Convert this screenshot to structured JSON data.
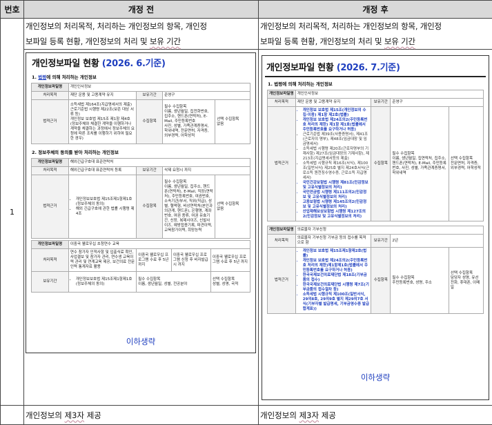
{
  "header": {
    "no": "번호",
    "before": "개정 전",
    "after": "개정 후"
  },
  "row1": {
    "no": "1",
    "topic_a1": "개인정보의 처리목적, 처리하는 개인정보의 항목, 개인정",
    "topic_a2_pre": "보파일 등록 현황, 개인정보의 처리 및 ",
    "topic_a2_u": "보유 기간",
    "topic_b1": "개인정보의 처리목적, 처리하는 개인정보의 항목, 개인정",
    "topic_b2_pre": "보파일 등록 현황, 개인정보의 처리 및 ",
    "topic_b2_u": "보유 기간"
  },
  "before_doc": {
    "title": "개인정보파일 현황",
    "date": "(2026. 6.기준)",
    "sec1_num": "1. ",
    "sec1_blue": "법령",
    "sec1_rest": "에 의해 처리하는 개인정보",
    "t1_name_k": "개인정보파일명",
    "t1_name_v": "개인인사정보",
    "t1_purpose_k": "처리목적",
    "t1_purpose_v": "재단 운용 및 고용계약 유지",
    "t1_retain_k": "보유기간",
    "t1_retain_v": "준영구",
    "t1_law_k": "법적근거",
    "t1_law_v": "소득세법 제164조(지급명세서의 제출)\n근로기준법 시행령 제22조(보존 대상 서류 등)\n개인정보 보호법 제15조 제1항 제4호(정보주체와 체결한 계약을 이행하거나 계약을 체결하는 과정에서 정보주체의 요청에 따른 조치를 이행하기 위하여 필요한 경우)",
    "t1_items_k": "수집항목",
    "t1_items_v": "필수 수집항목\n이름, 생년월일, 집전화번호, 집주소, 핸드폰(연락처), E-Mail, 주민등록번호\n사진, 성별, 가족관계증명서, 학위내역, 전문면허, 자격증, 외부경력, 어학성적",
    "t1_sel_k": "선택 수집항목",
    "t1_sel_v": "없음",
    "sec2": "2. 정보주체의 동의를 받아 처리하는 개인정보",
    "t2_name_k": "개인정보파일명",
    "t2_name_v": "해외긴급구호대 표준연락처",
    "t2_purpose_k": "처리목적",
    "t2_purpose_v": "해외긴급구호대 표준연락처 등록",
    "t2_retain_k": "보유기간",
    "t2_retain_v": "삭제 요청시 까지",
    "t2_law_k": "법적근거",
    "t2_law_v1": "개인정보보호법 제15조제1항제1호(정보주체의 동의)",
    "t2_law_v2": "해외 긴급구호에 관한 법률 시행령 제4조",
    "t2_items_k": "수집항목",
    "t2_items_v": "필수 수집항목\n이름, 생년월일, 집주소, 핸드폰(연락처), E-Mail, 직장(연락처), 주민등록번호, 여권번호, 소속기관/부서, 직위(직급), 성별, 혈액형, 비상연락처(본인과의관계, 핸드폰), 은행명, 계좌번호, 여권 종류, 여권 유효기간, 신장, 복제사이즈, 신발사이즈, 예방접종기록, 파견이력, 교육참가이력, 희망능력",
    "t2_sel_k": "선택 수집항목",
    "t2_sel_v": "없음",
    "t3_name_k": "개인정보파일명",
    "t3_name_v": "이중국 웰로우십 초청연수 교육",
    "t3_purpose_k": "처리목적",
    "t3_purpose_v": "연수 참가자 인적사항 및 입출식료 확인, 사업결보 및 참가자 관리, 연수생 교육이력 관리 및 연계교육 제공, 보건의료 전문인력 통계자료 활용",
    "t3_retain_k": "보유기간",
    "t3_retain_v1": "이중국 웰로우십 프로그램 수료 후 5년 까지",
    "t3_retain_v2": "이중국 웰로우십 프로그램 신청 후 비자발급 시 까지",
    "t3_retain_v3": "이중국 웰로우십 프로그램 수료 후 5년 까지",
    "t3_law_v": "개인정보보호법 제15조제1항제1호(정보주체의 동의)",
    "t3_items_v": "필수 수집항목\n이름, 생년월일, 성별, 전공분야",
    "t3_sel_v": "선택 수집항목\n성별, 성명, 국적",
    "note": "이하생략"
  },
  "after_doc": {
    "title": "개인정보파일 현황",
    "date": "(2026. 7.기준)",
    "sec1": "1. 법령에 의해 처리하는 개인정보",
    "t1_name_k": "개인정보파일명",
    "t1_name_v": "개인인사정보",
    "t1_purpose_k": "처리목적",
    "t1_purpose_v": "재단 운용 및 고용계약 유지",
    "t1_retain_k": "보유기간",
    "t1_retain_v": "준영구",
    "t1_law_k": "법적근거",
    "t1_law_items": [
      "개인정보 보호법 제15조(개인정보의 수집·이용) 제1항 제2호(법률)",
      "개인정보 보호법 제24조의2(주민등록번호 처리의 제한) 제1항 제1호(법률에서 주민등록번호를 요구하거나 허용)",
      "근로기준법 제39조(사용증명서), 제41조(근로자의 명부), 제48조(임금대장 및 임금명세서)",
      "소득세법 시행령 제20조(근로자명부의 기재사항) 제27조(임금대장의 기재사항), 제213조(지급명세서등의 제출)",
      "소득세법 시행규칙 제16조(서식), 제100조(일반서식) 제25호 별지 제24호서식(근로소득 원천징수영수증, 근로소득 지급명세서)",
      "국민건강보험법 시행령 제81조(민감정보 및 고유식별정보의 처리)",
      "국민연금법 시행령 제111조의2(민감정보 및 고유식별정보의 처리)",
      "고용보험법 시행령 제145조의2(민감정보 및 고유식별정보의 처리)",
      "산업재해보상보험법 시행령 제127조의2(민감정보 및 고유식별정보의 처리)"
    ],
    "t1_items_k": "수집항목",
    "t1_items_v": "필수 수집항목\n이름, 생년월일, 집연락처, 집주소, 핸드폰(연락처), E-Mail, 주민등록번호, 사진, 성별, 가족관계증명서, 학위내역",
    "t1_sel_v": "선택 수집항목\n전문면허, 자격증, 외부경력, 어학성적",
    "t2_name_k": "개인정보파일명",
    "t2_name_v": "의료물자 기부신청",
    "t2_purpose_k": "처리목적",
    "t2_purpose_v": "의료물자 기부신청 기부금 등의 접수를 목적으로 함",
    "t2_retain_k": "보유기간",
    "t2_retain_v": "2년",
    "t2_law_k": "법적근거",
    "t2_law_items": [
      "개인정보 보호법 제15조제1항제2호(법률)",
      "개인정보 보호법 제24조의2(주민등록번호 처리의 제한)제1항제1호(법률에서 주민등록번호를 요구하거나 허용)",
      "한국국제보건의료재단법 제18조(기부금품의 접수)",
      "한국국제보건의료재단법 시행령 제7조(기부금품의 접수절차 등)",
      "소득세법 시행규칙 제100조(일반서식, 29의8호, 29의9호 별지 제29의7호 서식(기부자별 발급명세, 기부금영수증 발급합계표))"
    ],
    "t2_items_k": "수집항목",
    "t2_items_v": "필수 수집항목\n주민등록번호, 성명, 주소",
    "t2_sel_v": "선택 수집항목\n담당자 성명, 유선전화, 휴대폰, 이메일",
    "note": "이하생략"
  },
  "footer": {
    "a_pre": "개인정보의 ",
    "a_u": "제3자",
    "a_post": " 제공",
    "b_pre": "개인정보의 ",
    "b_u": "제3자",
    "b_post": " 제공"
  }
}
